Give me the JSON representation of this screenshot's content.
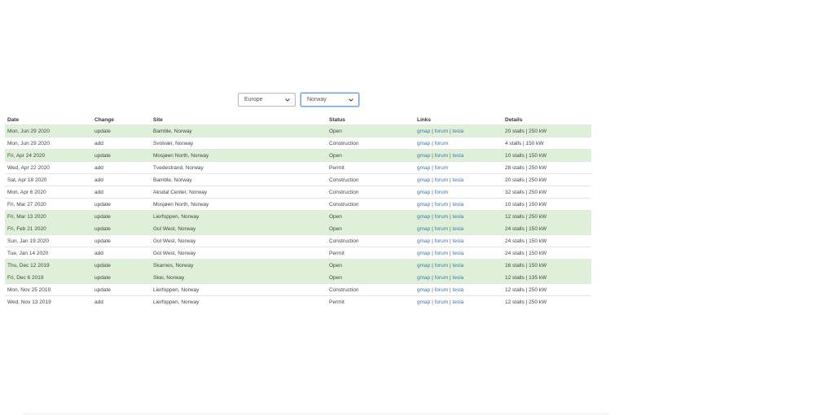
{
  "filters": {
    "region": "Europe",
    "country": "Norway"
  },
  "table": {
    "headers": [
      "Date",
      "Change",
      "Site",
      "Status",
      "Links",
      "Details"
    ],
    "link_separator": "|",
    "rows": [
      {
        "date": "Mon, Jun 29 2020",
        "change": "update",
        "site": "Bamble, Norway",
        "status": "Open",
        "links": [
          "gmap",
          "forum",
          "tesla"
        ],
        "details": "20 stalls | 250 kW"
      },
      {
        "date": "Mon, Jun 29 2020",
        "change": "add",
        "site": "Svolvær, Norway",
        "status": "Construction",
        "links": [
          "gmap",
          "forum"
        ],
        "details": "4 stalls | 150 kW"
      },
      {
        "date": "Fri, Apr 24 2020",
        "change": "update",
        "site": "Mosjøen North, Norway",
        "status": "Open",
        "links": [
          "gmap",
          "forum",
          "tesla"
        ],
        "details": "10 stalls | 150 kW"
      },
      {
        "date": "Wed, Apr 22 2020",
        "change": "add",
        "site": "Tvedestrand, Norway",
        "status": "Permit",
        "links": [
          "gmap",
          "forum"
        ],
        "details": "28 stalls | 250 kW"
      },
      {
        "date": "Sat, Apr 18 2020",
        "change": "add",
        "site": "Bamble, Norway",
        "status": "Construction",
        "links": [
          "gmap",
          "forum",
          "tesla"
        ],
        "details": "20 stalls | 250 kW"
      },
      {
        "date": "Mon, Apr 6 2020",
        "change": "add",
        "site": "Aksdal Center, Norway",
        "status": "Construction",
        "links": [
          "gmap",
          "forum"
        ],
        "details": "32 stalls | 250 kW"
      },
      {
        "date": "Fri, Mar 27 2020",
        "change": "update",
        "site": "Mosjøen North, Norway",
        "status": "Construction",
        "links": [
          "gmap",
          "forum",
          "tesla"
        ],
        "details": "10 stalls | 150 kW"
      },
      {
        "date": "Fri, Mar 13 2020",
        "change": "update",
        "site": "Lierfoppen, Norway",
        "status": "Open",
        "links": [
          "gmap",
          "forum",
          "tesla"
        ],
        "details": "12 stalls | 250 kW"
      },
      {
        "date": "Fri, Feb 21 2020",
        "change": "update",
        "site": "Gol West, Norway",
        "status": "Open",
        "links": [
          "gmap",
          "forum",
          "tesla"
        ],
        "details": "24 stalls | 150 kW"
      },
      {
        "date": "Sun, Jan 19 2020",
        "change": "update",
        "site": "Gol West, Norway",
        "status": "Construction",
        "links": [
          "gmap",
          "forum",
          "tesla"
        ],
        "details": "24 stalls | 150 kW"
      },
      {
        "date": "Tue, Jan 14 2020",
        "change": "add",
        "site": "Gol West, Norway",
        "status": "Permit",
        "links": [
          "gmap",
          "forum",
          "tesla"
        ],
        "details": "24 stalls | 150 kW"
      },
      {
        "date": "Thu, Dec 12 2019",
        "change": "update",
        "site": "Skarnes, Norway",
        "status": "Open",
        "links": [
          "gmap",
          "forum",
          "tesla"
        ],
        "details": "16 stalls | 150 kW"
      },
      {
        "date": "Fri, Dec 6 2019",
        "change": "update",
        "site": "Skei, Norway",
        "status": "Open",
        "links": [
          "gmap",
          "forum",
          "tesla"
        ],
        "details": "12 stalls | 135 kW"
      },
      {
        "date": "Mon, Nov 25 2019",
        "change": "update",
        "site": "Lierfoppen, Norway",
        "status": "Construction",
        "links": [
          "gmap",
          "forum",
          "tesla"
        ],
        "details": "12 stalls | 250 kW"
      },
      {
        "date": "Wed, Nov 13 2019",
        "change": "add",
        "site": "Lierfoppen, Norway",
        "status": "Permit",
        "links": [
          "gmap",
          "forum",
          "tesla"
        ],
        "details": "12 stalls | 250 kW"
      }
    ]
  },
  "colors": {
    "open_row_bg": "#dff0d8",
    "construction": "#f0a030",
    "permit": "#2a3fbf",
    "link": "#3c78b4"
  },
  "icons": {
    "dropdown": "chevron-down-icon"
  }
}
